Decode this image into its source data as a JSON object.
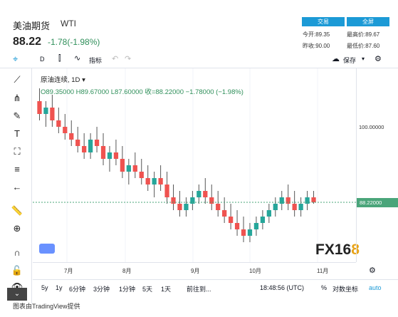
{
  "header": {
    "title": "美油期货",
    "symbol": "WTI",
    "price": "88.22",
    "change": "-1.78(-1.98%)",
    "btn_trade": "交易",
    "btn_fullscreen": "全屏",
    "stats": [
      {
        "label": "今开:",
        "value": "89.35"
      },
      {
        "label": "最高价:",
        "value": "89.67"
      },
      {
        "label": "昨收:",
        "value": "90.00"
      },
      {
        "label": "最低价:",
        "value": "87.60"
      }
    ]
  },
  "toolbar": {
    "interval": "D",
    "indicators": "指标",
    "save": "保存"
  },
  "legend": {
    "series": "原油连续, 1D",
    "ohlc": "O89.35000  H89.67000  L87.60000  收=88.22000  −1.78000 (−1.98%)"
  },
  "price_scale": {
    "level": "100.00000",
    "current": "88.22000"
  },
  "time_axis": [
    "7月",
    "8月",
    "9月",
    "10月",
    "11月"
  ],
  "bottom": {
    "ranges": [
      "5y",
      "1y",
      "6分钟",
      "3分钟",
      "1分钟",
      "5天",
      "1天"
    ],
    "goto": "前往到...",
    "clock": "18:48:56 (UTC)",
    "percent": "%",
    "log": "对数坐标",
    "auto": "auto"
  },
  "credit": "图表由TradingView提供",
  "watermark": "FX168",
  "colors": {
    "up": "#26a69a",
    "down": "#ef5350",
    "accent": "#1c9ad6"
  },
  "chart_data": {
    "type": "candlestick",
    "y_ref": 100,
    "current": 88.22,
    "candles": [
      [
        104,
        106,
        101,
        102
      ],
      [
        102,
        104,
        100,
        103
      ],
      [
        103,
        105,
        100,
        101
      ],
      [
        101,
        103,
        99,
        100
      ],
      [
        100,
        102,
        98,
        99
      ],
      [
        99,
        101,
        97,
        98
      ],
      [
        98,
        100,
        96,
        97
      ],
      [
        97,
        99,
        95,
        96
      ],
      [
        96,
        99,
        95,
        98
      ],
      [
        98,
        100,
        96,
        97
      ],
      [
        97,
        99,
        94,
        95
      ],
      [
        95,
        97,
        93,
        96
      ],
      [
        96,
        98,
        94,
        95
      ],
      [
        95,
        97,
        92,
        93
      ],
      [
        93,
        95,
        91,
        94
      ],
      [
        94,
        96,
        92,
        93
      ],
      [
        93,
        95,
        91,
        92
      ],
      [
        92,
        94,
        90,
        91
      ],
      [
        91,
        93,
        89,
        92
      ],
      [
        92,
        94,
        90,
        91
      ],
      [
        91,
        93,
        88,
        89
      ],
      [
        89,
        91,
        87,
        88
      ],
      [
        88,
        90,
        86,
        87
      ],
      [
        87,
        89,
        86,
        88
      ],
      [
        88,
        90,
        87,
        89
      ],
      [
        89,
        91,
        88,
        90
      ],
      [
        90,
        92,
        88,
        89
      ],
      [
        89,
        91,
        87,
        88
      ],
      [
        88,
        90,
        86,
        87
      ],
      [
        87,
        89,
        85,
        86
      ],
      [
        86,
        88,
        84,
        85
      ],
      [
        85,
        87,
        83,
        84
      ],
      [
        84,
        86,
        82,
        83
      ],
      [
        83,
        85,
        82,
        84
      ],
      [
        84,
        86,
        83,
        85
      ],
      [
        85,
        87,
        84,
        86
      ],
      [
        86,
        88,
        85,
        87
      ],
      [
        87,
        89,
        86,
        88
      ],
      [
        88,
        90,
        87,
        89
      ],
      [
        89,
        91,
        87,
        88
      ],
      [
        88,
        90,
        86,
        87
      ],
      [
        87,
        89,
        86,
        88
      ],
      [
        88,
        90,
        87,
        89
      ],
      [
        89,
        90,
        88,
        88.22
      ]
    ]
  }
}
